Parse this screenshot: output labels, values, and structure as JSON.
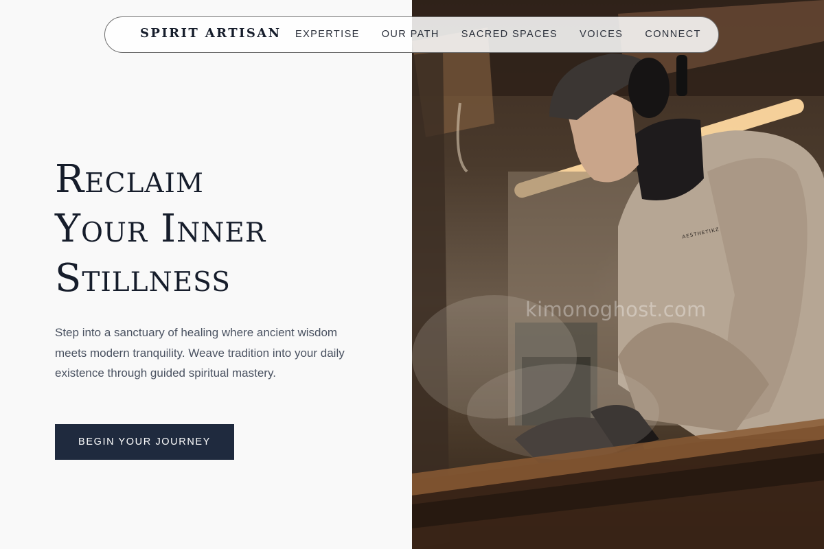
{
  "brand": "SPIRIT ARTISAN",
  "nav": {
    "links": [
      "EXPERTISE",
      "OUR PATH",
      "SACRED SPACES",
      "VOICES",
      "CONNECT"
    ]
  },
  "hero": {
    "headline_lines": [
      "Reclaim",
      "Your Inner",
      "Stillness"
    ],
    "intro": "Step into a sanctuary of healing where ancient wisdom meets modern tranquility. Weave tradition into your daily existence through guided spiritual mastery.",
    "cta_label": "BEGIN YOUR JOURNEY"
  },
  "image": {
    "watermark": "kimonoghost.com",
    "sweatshirt_text": "AESTHETIKZ"
  },
  "colors": {
    "navy": "#1f2a3e",
    "text_dark": "#161d2b",
    "text_body": "#4a5261",
    "background": "#f9f9f9"
  }
}
